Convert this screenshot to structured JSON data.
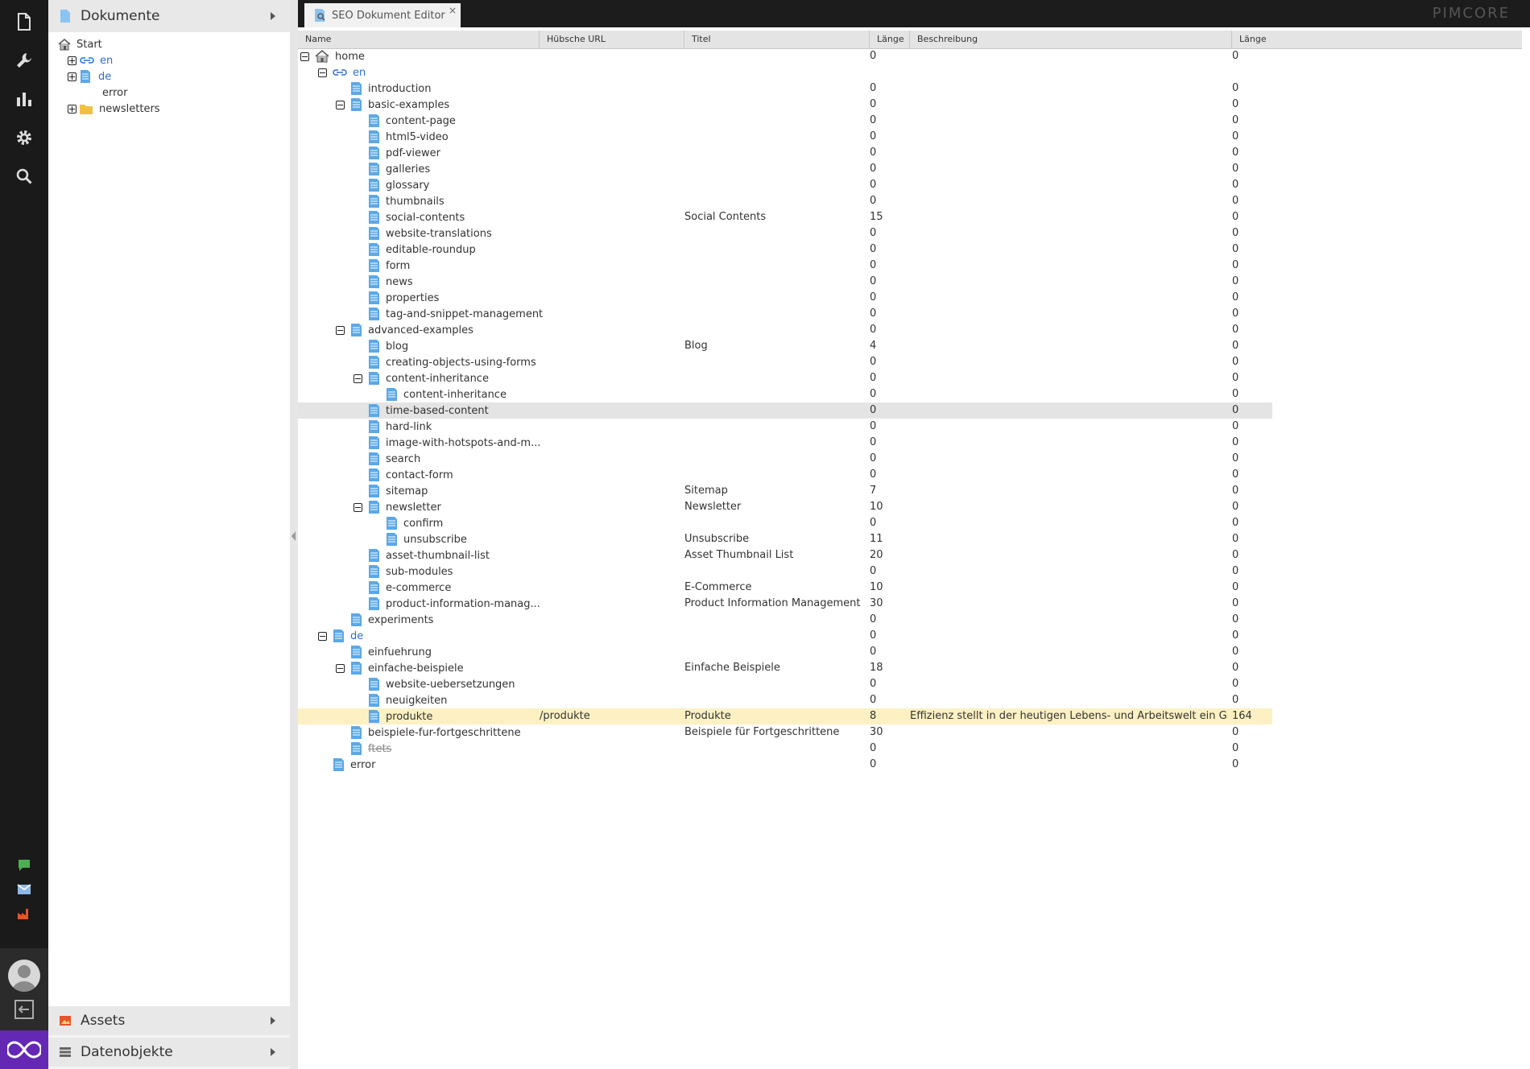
{
  "left_panel": {
    "documents_title": "Dokumente",
    "assets_title": "Assets",
    "objects_title": "Datenobjekte",
    "tree": [
      {
        "label": "Start",
        "icon": "home-icon",
        "toggle": "none",
        "depth": 0
      },
      {
        "label": "en",
        "icon": "link-icon",
        "toggle": "plus",
        "depth": 1
      },
      {
        "label": "de",
        "icon": "document-icon",
        "toggle": "plus",
        "depth": 1
      },
      {
        "label": "error",
        "icon": "none",
        "toggle": "none",
        "depth": 1
      },
      {
        "label": "newsletters",
        "icon": "folder-icon",
        "toggle": "plus",
        "depth": 1
      }
    ]
  },
  "tab": {
    "label": "SEO Dokument Editor",
    "close": "×"
  },
  "logo": "PIMCORE",
  "grid": {
    "columns": [
      "Name",
      "Hübsche URL",
      "Titel",
      "Länge",
      "Beschreibung",
      "Länge"
    ],
    "rows": [
      {
        "name": "home",
        "depth": 0,
        "toggle": "minus",
        "icon": "home",
        "url": "",
        "title": "",
        "tlen": "0",
        "desc": "",
        "dlen": "0"
      },
      {
        "name": "en",
        "depth": 1,
        "toggle": "minus",
        "icon": "link",
        "url": "",
        "title": "",
        "tlen": "",
        "desc": "",
        "dlen": ""
      },
      {
        "name": "introduction",
        "depth": 2,
        "toggle": "none",
        "icon": "doc",
        "url": "",
        "title": "",
        "tlen": "0",
        "desc": "",
        "dlen": "0"
      },
      {
        "name": "basic-examples",
        "depth": 2,
        "toggle": "minus",
        "icon": "doc",
        "url": "",
        "title": "",
        "tlen": "0",
        "desc": "",
        "dlen": "0"
      },
      {
        "name": "content-page",
        "depth": 3,
        "toggle": "none",
        "icon": "doc",
        "url": "",
        "title": "",
        "tlen": "0",
        "desc": "",
        "dlen": "0"
      },
      {
        "name": "html5-video",
        "depth": 3,
        "toggle": "none",
        "icon": "doc",
        "url": "",
        "title": "",
        "tlen": "0",
        "desc": "",
        "dlen": "0"
      },
      {
        "name": "pdf-viewer",
        "depth": 3,
        "toggle": "none",
        "icon": "doc",
        "url": "",
        "title": "",
        "tlen": "0",
        "desc": "",
        "dlen": "0"
      },
      {
        "name": "galleries",
        "depth": 3,
        "toggle": "none",
        "icon": "doc",
        "url": "",
        "title": "",
        "tlen": "0",
        "desc": "",
        "dlen": "0"
      },
      {
        "name": "glossary",
        "depth": 3,
        "toggle": "none",
        "icon": "doc",
        "url": "",
        "title": "",
        "tlen": "0",
        "desc": "",
        "dlen": "0"
      },
      {
        "name": "thumbnails",
        "depth": 3,
        "toggle": "none",
        "icon": "doc",
        "url": "",
        "title": "",
        "tlen": "0",
        "desc": "",
        "dlen": "0"
      },
      {
        "name": "social-contents",
        "depth": 3,
        "toggle": "none",
        "icon": "doc",
        "url": "",
        "title": "Social Contents",
        "tlen": "15",
        "desc": "",
        "dlen": "0"
      },
      {
        "name": "website-translations",
        "depth": 3,
        "toggle": "none",
        "icon": "doc",
        "url": "",
        "title": "",
        "tlen": "0",
        "desc": "",
        "dlen": "0"
      },
      {
        "name": "editable-roundup",
        "depth": 3,
        "toggle": "none",
        "icon": "doc",
        "url": "",
        "title": "",
        "tlen": "0",
        "desc": "",
        "dlen": "0"
      },
      {
        "name": "form",
        "depth": 3,
        "toggle": "none",
        "icon": "doc",
        "url": "",
        "title": "",
        "tlen": "0",
        "desc": "",
        "dlen": "0"
      },
      {
        "name": "news",
        "depth": 3,
        "toggle": "none",
        "icon": "doc",
        "url": "",
        "title": "",
        "tlen": "0",
        "desc": "",
        "dlen": "0"
      },
      {
        "name": "properties",
        "depth": 3,
        "toggle": "none",
        "icon": "doc",
        "url": "",
        "title": "",
        "tlen": "0",
        "desc": "",
        "dlen": "0"
      },
      {
        "name": "tag-and-snippet-management",
        "depth": 3,
        "toggle": "none",
        "icon": "doc",
        "url": "",
        "title": "",
        "tlen": "0",
        "desc": "",
        "dlen": "0"
      },
      {
        "name": "advanced-examples",
        "depth": 2,
        "toggle": "minus",
        "icon": "doc",
        "url": "",
        "title": "",
        "tlen": "0",
        "desc": "",
        "dlen": "0"
      },
      {
        "name": "blog",
        "depth": 3,
        "toggle": "none",
        "icon": "doc",
        "url": "",
        "title": "Blog",
        "tlen": "4",
        "desc": "",
        "dlen": "0"
      },
      {
        "name": "creating-objects-using-forms",
        "depth": 3,
        "toggle": "none",
        "icon": "doc",
        "url": "",
        "title": "",
        "tlen": "0",
        "desc": "",
        "dlen": "0"
      },
      {
        "name": "content-inheritance",
        "depth": 3,
        "toggle": "minus",
        "icon": "doc",
        "url": "",
        "title": "",
        "tlen": "0",
        "desc": "",
        "dlen": "0"
      },
      {
        "name": "content-inheritance",
        "depth": 4,
        "toggle": "none",
        "icon": "doc",
        "url": "",
        "title": "",
        "tlen": "0",
        "desc": "",
        "dlen": "0"
      },
      {
        "name": "time-based-content",
        "depth": 3,
        "toggle": "none",
        "icon": "doc",
        "url": "",
        "title": "",
        "tlen": "0",
        "desc": "",
        "dlen": "0",
        "highlight": "grey"
      },
      {
        "name": "hard-link",
        "depth": 3,
        "toggle": "none",
        "icon": "doc",
        "url": "",
        "title": "",
        "tlen": "0",
        "desc": "",
        "dlen": "0"
      },
      {
        "name": "image-with-hotspots-and-m...",
        "depth": 3,
        "toggle": "none",
        "icon": "doc",
        "url": "",
        "title": "",
        "tlen": "0",
        "desc": "",
        "dlen": "0"
      },
      {
        "name": "search",
        "depth": 3,
        "toggle": "none",
        "icon": "doc",
        "url": "",
        "title": "",
        "tlen": "0",
        "desc": "",
        "dlen": "0"
      },
      {
        "name": "contact-form",
        "depth": 3,
        "toggle": "none",
        "icon": "doc",
        "url": "",
        "title": "",
        "tlen": "0",
        "desc": "",
        "dlen": "0"
      },
      {
        "name": "sitemap",
        "depth": 3,
        "toggle": "none",
        "icon": "doc",
        "url": "",
        "title": "Sitemap",
        "tlen": "7",
        "desc": "",
        "dlen": "0"
      },
      {
        "name": "newsletter",
        "depth": 3,
        "toggle": "minus",
        "icon": "doc",
        "url": "",
        "title": "Newsletter",
        "tlen": "10",
        "desc": "",
        "dlen": "0"
      },
      {
        "name": "confirm",
        "depth": 4,
        "toggle": "none",
        "icon": "doc",
        "url": "",
        "title": "",
        "tlen": "0",
        "desc": "",
        "dlen": "0"
      },
      {
        "name": "unsubscribe",
        "depth": 4,
        "toggle": "none",
        "icon": "doc",
        "url": "",
        "title": "Unsubscribe",
        "tlen": "11",
        "desc": "",
        "dlen": "0"
      },
      {
        "name": "asset-thumbnail-list",
        "depth": 3,
        "toggle": "none",
        "icon": "doc",
        "url": "",
        "title": "Asset Thumbnail List",
        "tlen": "20",
        "desc": "",
        "dlen": "0"
      },
      {
        "name": "sub-modules",
        "depth": 3,
        "toggle": "none",
        "icon": "doc",
        "url": "",
        "title": "",
        "tlen": "0",
        "desc": "",
        "dlen": "0"
      },
      {
        "name": "e-commerce",
        "depth": 3,
        "toggle": "none",
        "icon": "doc",
        "url": "",
        "title": "E-Commerce",
        "tlen": "10",
        "desc": "",
        "dlen": "0"
      },
      {
        "name": "product-information-manag...",
        "depth": 3,
        "toggle": "none",
        "icon": "doc",
        "url": "",
        "title": "Product Information Management",
        "tlen": "30",
        "desc": "",
        "dlen": "0"
      },
      {
        "name": "experiments",
        "depth": 2,
        "toggle": "none",
        "icon": "doc",
        "url": "",
        "title": "",
        "tlen": "0",
        "desc": "",
        "dlen": "0"
      },
      {
        "name": "de",
        "depth": 1,
        "toggle": "minus",
        "icon": "doc",
        "url": "",
        "title": "",
        "tlen": "0",
        "desc": "",
        "dlen": "0",
        "link": true
      },
      {
        "name": "einfuehrung",
        "depth": 2,
        "toggle": "none",
        "icon": "doc",
        "url": "",
        "title": "",
        "tlen": "0",
        "desc": "",
        "dlen": "0"
      },
      {
        "name": "einfache-beispiele",
        "depth": 2,
        "toggle": "minus",
        "icon": "doc",
        "url": "",
        "title": "Einfache Beispiele",
        "tlen": "18",
        "desc": "",
        "dlen": "0"
      },
      {
        "name": "website-uebersetzungen",
        "depth": 3,
        "toggle": "none",
        "icon": "doc",
        "url": "",
        "title": "",
        "tlen": "0",
        "desc": "",
        "dlen": "0"
      },
      {
        "name": "neuigkeiten",
        "depth": 3,
        "toggle": "none",
        "icon": "doc",
        "url": "",
        "title": "",
        "tlen": "0",
        "desc": "",
        "dlen": "0"
      },
      {
        "name": "produkte",
        "depth": 3,
        "toggle": "none",
        "icon": "doc",
        "url": "/produkte",
        "title": "Produkte",
        "tlen": "8",
        "desc": "Effizienz stellt in der heutigen Lebens- und Arbeitswelt ein Gru...",
        "dlen": "164",
        "highlight": "yellow"
      },
      {
        "name": "beispiele-fur-fortgeschrittene",
        "depth": 2,
        "toggle": "none",
        "icon": "doc",
        "url": "",
        "title": "Beispiele für Fortgeschrittene",
        "tlen": "30",
        "desc": "",
        "dlen": "0"
      },
      {
        "name": "ftets",
        "depth": 2,
        "toggle": "none",
        "icon": "doc",
        "url": "",
        "title": "",
        "tlen": "0",
        "desc": "",
        "dlen": "0",
        "strike": true
      },
      {
        "name": "error",
        "depth": 1,
        "toggle": "none",
        "icon": "doc",
        "url": "",
        "title": "",
        "tlen": "0",
        "desc": "",
        "dlen": "0"
      }
    ]
  },
  "colors": {
    "nav_bg": "#1a1a1a",
    "brand": "#6428b4",
    "highlight_yellow": "#fdf1c3",
    "highlight_grey": "#e4e4e4",
    "doc_icon": "#5ba8e8",
    "link": "#2a6fd4"
  }
}
